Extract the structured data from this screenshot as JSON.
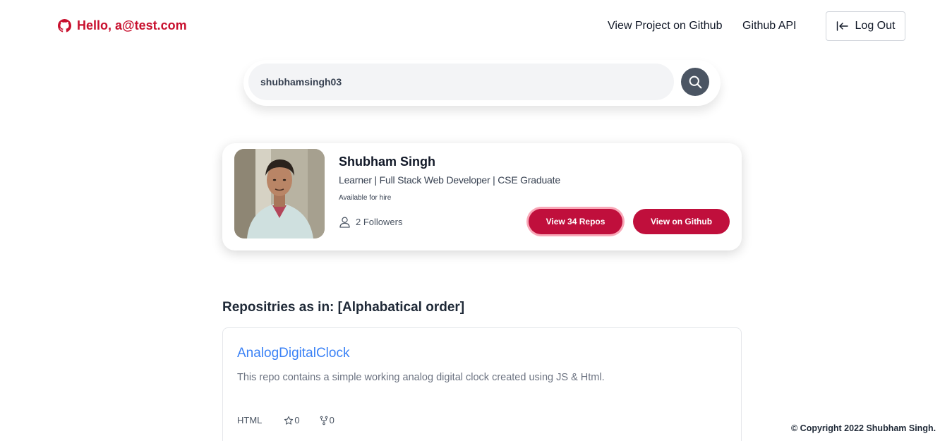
{
  "header": {
    "greeting": "Hello, a@test.com",
    "nav_project": "View Project on Github",
    "nav_api": "Github API",
    "logout_label": "Log Out"
  },
  "search": {
    "value": "shubhamsingh03"
  },
  "profile": {
    "name": "Shubham Singh",
    "bio": "Learner | Full Stack Web Developer | CSE Graduate",
    "status": "Available for hire",
    "followers": "2 Followers",
    "repos_button": "View 34 Repos",
    "github_button": "View on Github"
  },
  "repos_section": {
    "title": "Repositries as in: [Alphabatical order]",
    "items": [
      {
        "name": "AnalogDigitalClock",
        "description": "This repo contains a simple working analog digital clock created using JS & Html.",
        "language": "HTML",
        "stars": "0",
        "forks": "0"
      }
    ]
  },
  "footer": {
    "copyright": "© Copyright 2022 Shubham Singh."
  },
  "colors": {
    "accent": "#c00f3c",
    "greeting": "#c8102e",
    "link": "#3b82f6",
    "search_button": "#4b5563"
  },
  "icons": {
    "greeting": "github-icon",
    "logout": "logout-icon",
    "search": "search-icon",
    "followers": "user-icon",
    "stars": "star-icon",
    "forks": "fork-icon"
  }
}
